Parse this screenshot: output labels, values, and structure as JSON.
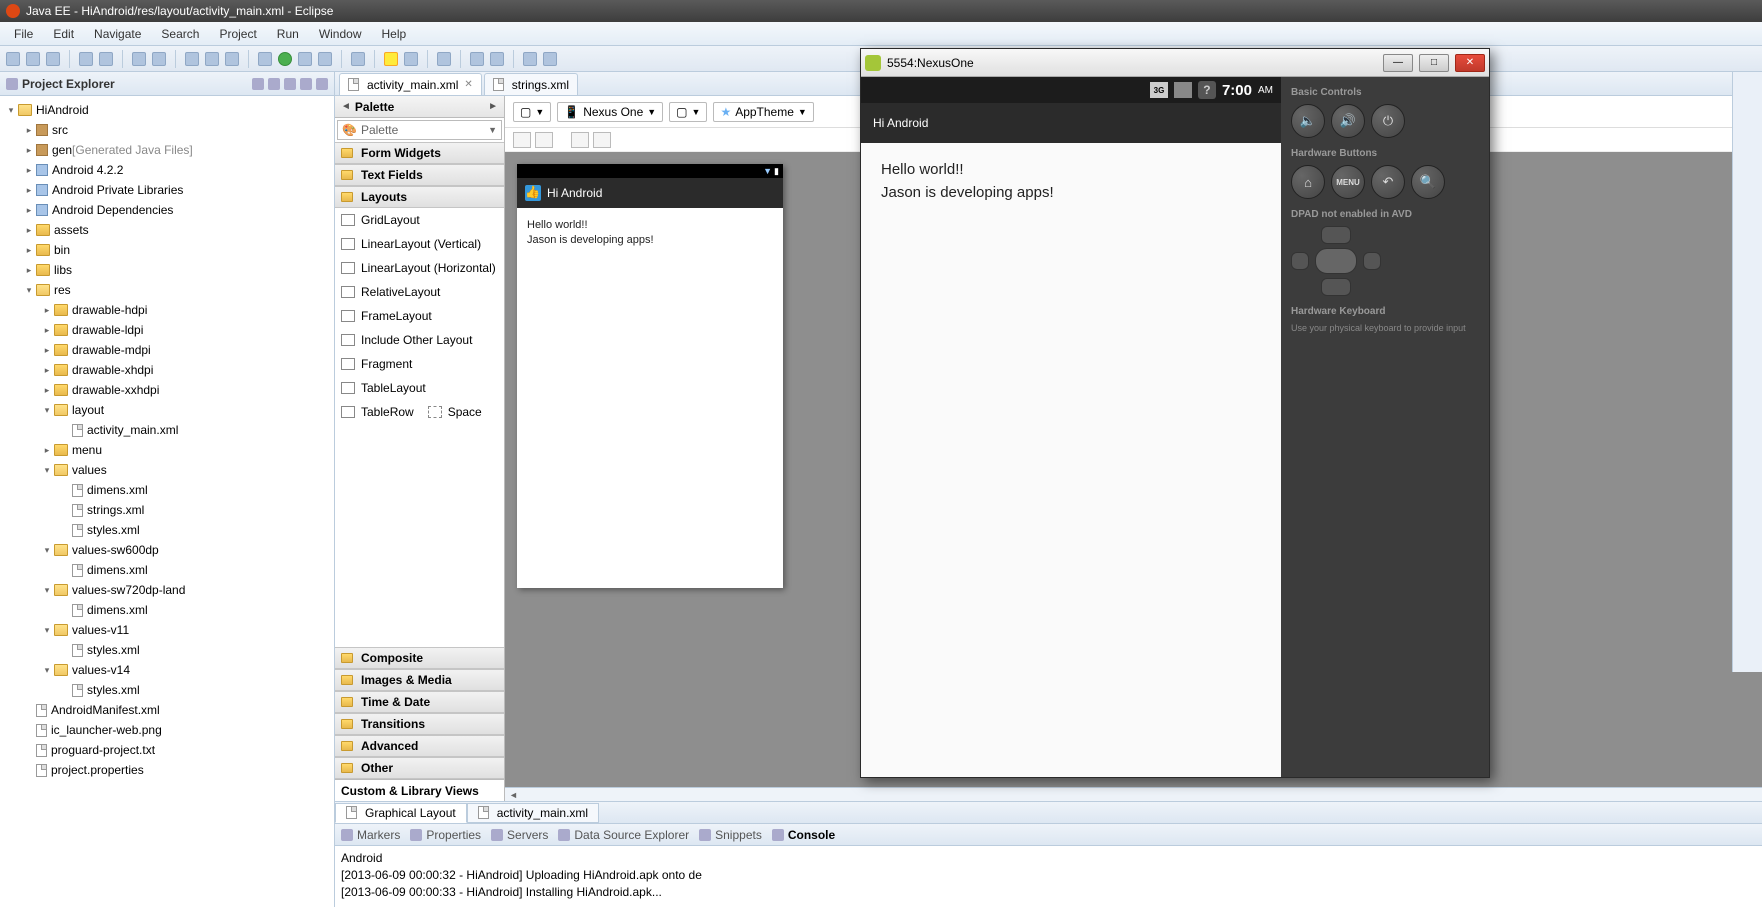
{
  "window": {
    "title": "Java EE - HiAndroid/res/layout/activity_main.xml - Eclipse"
  },
  "menu": [
    "File",
    "Edit",
    "Navigate",
    "Search",
    "Project",
    "Run",
    "Window",
    "Help"
  ],
  "explorer": {
    "title": "Project Explorer",
    "project": "HiAndroid",
    "nodes": [
      {
        "l": "src",
        "t": "pkg",
        "d": 1
      },
      {
        "l": "gen",
        "suffix": "[Generated Java Files]",
        "t": "pkg",
        "d": 1
      },
      {
        "l": "Android 4.2.2",
        "t": "jar",
        "d": 1
      },
      {
        "l": "Android Private Libraries",
        "t": "jar",
        "d": 1
      },
      {
        "l": "Android Dependencies",
        "t": "jar",
        "d": 1
      },
      {
        "l": "assets",
        "t": "fld",
        "d": 1
      },
      {
        "l": "bin",
        "t": "fld",
        "d": 1
      },
      {
        "l": "libs",
        "t": "fld",
        "d": 1
      },
      {
        "l": "res",
        "t": "fld",
        "d": 1,
        "open": true
      },
      {
        "l": "drawable-hdpi",
        "t": "fld",
        "d": 2
      },
      {
        "l": "drawable-ldpi",
        "t": "fld",
        "d": 2
      },
      {
        "l": "drawable-mdpi",
        "t": "fld",
        "d": 2
      },
      {
        "l": "drawable-xhdpi",
        "t": "fld",
        "d": 2
      },
      {
        "l": "drawable-xxhdpi",
        "t": "fld",
        "d": 2
      },
      {
        "l": "layout",
        "t": "fld",
        "d": 2,
        "open": true
      },
      {
        "l": "activity_main.xml",
        "t": "file",
        "d": 3
      },
      {
        "l": "menu",
        "t": "fld",
        "d": 2
      },
      {
        "l": "values",
        "t": "fld",
        "d": 2,
        "open": true
      },
      {
        "l": "dimens.xml",
        "t": "file",
        "d": 3
      },
      {
        "l": "strings.xml",
        "t": "file",
        "d": 3
      },
      {
        "l": "styles.xml",
        "t": "file",
        "d": 3
      },
      {
        "l": "values-sw600dp",
        "t": "fld",
        "d": 2,
        "open": true
      },
      {
        "l": "dimens.xml",
        "t": "file",
        "d": 3
      },
      {
        "l": "values-sw720dp-land",
        "t": "fld",
        "d": 2,
        "open": true
      },
      {
        "l": "dimens.xml",
        "t": "file",
        "d": 3
      },
      {
        "l": "values-v11",
        "t": "fld",
        "d": 2,
        "open": true
      },
      {
        "l": "styles.xml",
        "t": "file",
        "d": 3
      },
      {
        "l": "values-v14",
        "t": "fld",
        "d": 2,
        "open": true
      },
      {
        "l": "styles.xml",
        "t": "file",
        "d": 3
      },
      {
        "l": "AndroidManifest.xml",
        "t": "file",
        "d": 1
      },
      {
        "l": "ic_launcher-web.png",
        "t": "file",
        "d": 1
      },
      {
        "l": "proguard-project.txt",
        "t": "file",
        "d": 1
      },
      {
        "l": "project.properties",
        "t": "file",
        "d": 1
      }
    ]
  },
  "editor": {
    "tabs": [
      {
        "label": "activity_main.xml",
        "active": true
      },
      {
        "label": "strings.xml",
        "active": false
      }
    ],
    "bottomTabs": [
      {
        "label": "Graphical Layout",
        "active": true
      },
      {
        "label": "activity_main.xml",
        "active": false
      }
    ]
  },
  "palette": {
    "title": "Palette",
    "search_placeholder": "Palette",
    "cats_top": [
      "Form Widgets",
      "Text Fields",
      "Layouts"
    ],
    "layout_items": [
      "GridLayout",
      "LinearLayout (Vertical)",
      "LinearLayout (Horizontal)",
      "RelativeLayout",
      "FrameLayout",
      "Include Other Layout",
      "Fragment",
      "TableLayout",
      "TableRow",
      "Space"
    ],
    "cats_bottom": [
      "Composite",
      "Images & Media",
      "Time & Date",
      "Transitions",
      "Advanced",
      "Other",
      "Custom & Library Views"
    ]
  },
  "canvas_toolbar": {
    "device": "Nexus One",
    "theme": "AppTheme"
  },
  "preview": {
    "title": "Hi Android",
    "line1": "Hello world!!",
    "line2": "Jason is developing apps!"
  },
  "bottom_views": [
    "Markers",
    "Properties",
    "Servers",
    "Data Source Explorer",
    "Snippets",
    "Console"
  ],
  "console": {
    "header": "Android",
    "lines": [
      "[2013-06-09 00:00:32 - HiAndroid] Uploading HiAndroid.apk onto de",
      "[2013-06-09 00:00:33 - HiAndroid] Installing HiAndroid.apk..."
    ]
  },
  "emulator": {
    "title": "5554:NexusOne",
    "time": "7:00",
    "ampm": "AM",
    "action_title": "Hi Android",
    "line1": "Hello world!!",
    "line2": "Jason is developing apps!",
    "sections": {
      "basic": "Basic Controls",
      "hardware": "Hardware Buttons",
      "dpad": "DPAD not enabled in AVD",
      "keyboard_h": "Hardware Keyboard",
      "keyboard_t": "Use your physical keyboard to provide input"
    },
    "menu_label": "MENU"
  }
}
